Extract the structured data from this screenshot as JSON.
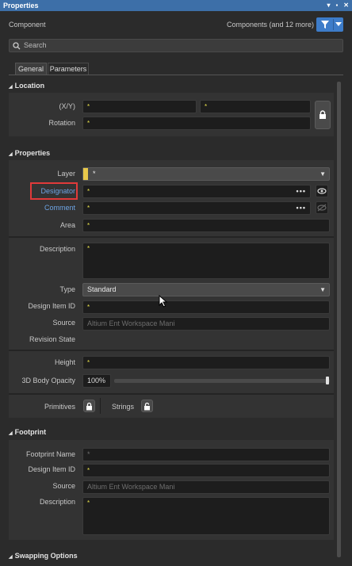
{
  "window": {
    "title": "Properties",
    "controls": [
      "▾",
      "▪",
      "✕"
    ]
  },
  "header": {
    "object_type": "Component",
    "filter_summary": "Components (and 12 more)"
  },
  "search": {
    "placeholder": "Search"
  },
  "tabs": [
    {
      "label": "General",
      "active": true
    },
    {
      "label": "Parameters",
      "active": false
    }
  ],
  "location": {
    "title": "Location",
    "xy_label": "(X/Y)",
    "x_value": "*",
    "y_value": "*",
    "rotation_label": "Rotation",
    "rotation_value": "*"
  },
  "properties": {
    "title": "Properties",
    "layer_label": "Layer",
    "layer_value": "*",
    "designator_label": "Designator",
    "designator_value": "*",
    "comment_label": "Comment",
    "comment_value": "*",
    "area_label": "Area",
    "area_value": "*",
    "description_label": "Description",
    "description_value": "*",
    "type_label": "Type",
    "type_value": "Standard",
    "design_item_id_label": "Design Item ID",
    "design_item_id_value": "*",
    "source_label": "Source",
    "source_value": "Altium Ent Workspace  Mani",
    "revision_state_label": "Revision State",
    "height_label": "Height",
    "height_value": "*",
    "opacity_label": "3D Body Opacity",
    "opacity_value": "100%",
    "opacity_level": 1.0,
    "primitives_label": "Primitives",
    "strings_label": "Strings"
  },
  "footprint": {
    "title": "Footprint",
    "name_label": "Footprint Name",
    "name_value": "*",
    "design_item_id_label": "Design Item ID",
    "design_item_id_value": "*",
    "source_label": "Source",
    "source_value": "Altium Ent Workspace  Mani",
    "description_label": "Description",
    "description_value": "*"
  },
  "swapping": {
    "title": "Swapping Options"
  },
  "colors": {
    "accent": "#3d6fa8",
    "link": "#6da4e4",
    "highlight": "#e03a3a",
    "layer_swatch": "#e8c84a",
    "value_dot": "#e8e04a"
  }
}
